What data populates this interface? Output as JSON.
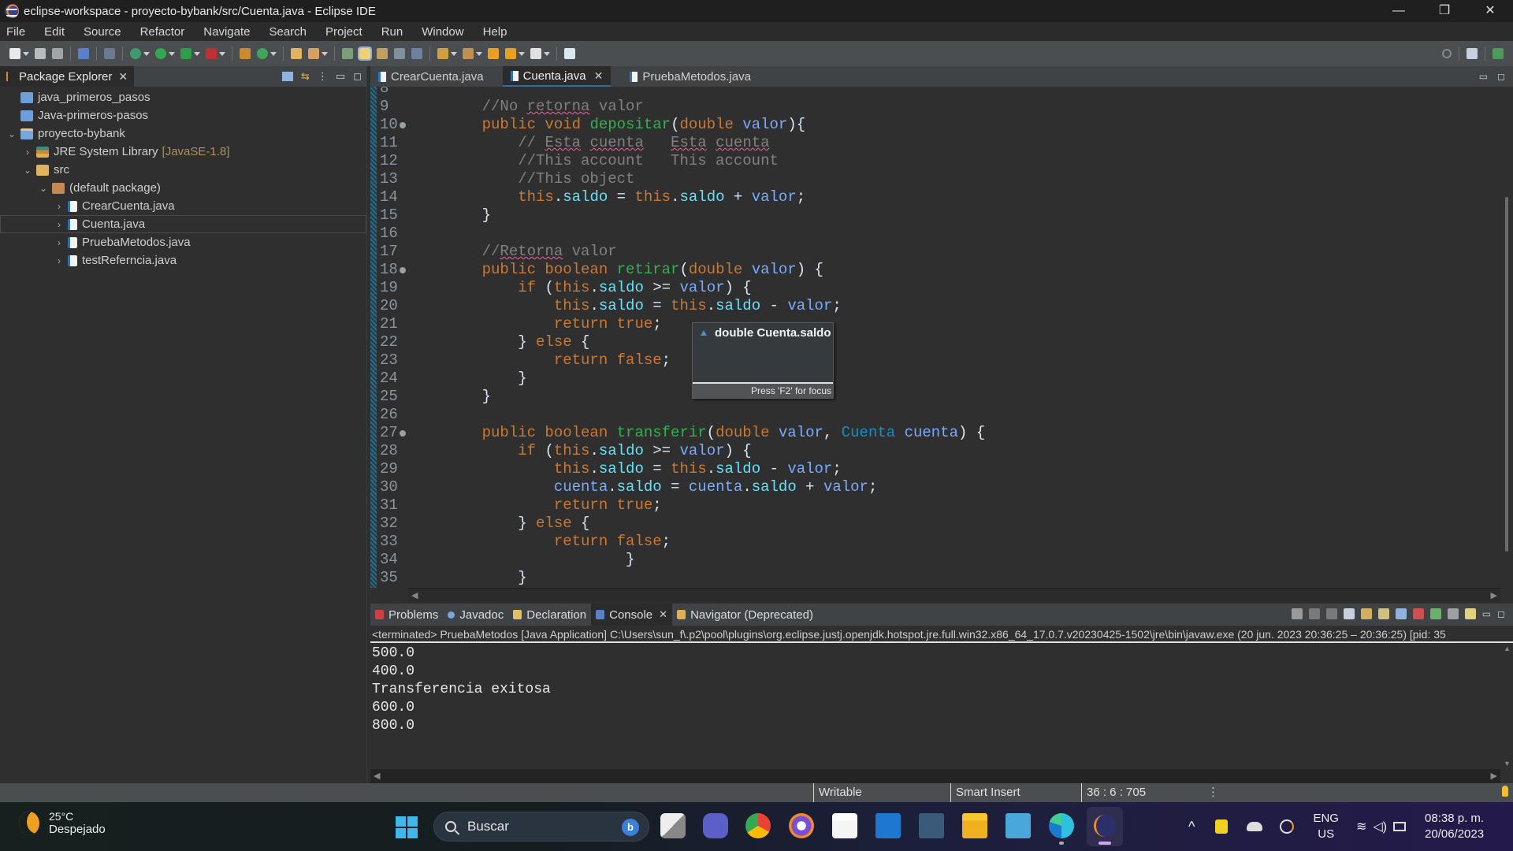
{
  "window": {
    "title": "eclipse-workspace - proyecto-bybank/src/Cuenta.java - Eclipse IDE",
    "controls": {
      "minimize": "—",
      "restore": "❐",
      "close": "✕"
    }
  },
  "menu": [
    "File",
    "Edit",
    "Source",
    "Refactor",
    "Navigate",
    "Search",
    "Project",
    "Run",
    "Window",
    "Help"
  ],
  "package_explorer": {
    "title": "Package Explorer",
    "close": "✕",
    "tree": [
      {
        "label": "java_primeros_pasos",
        "icon": "folder-icon",
        "depth": 0,
        "toggle": ""
      },
      {
        "label": "Java-primeros-pasos",
        "icon": "folder-icon",
        "depth": 0,
        "toggle": ""
      },
      {
        "label": "proyecto-bybank",
        "icon": "project-icon",
        "depth": 0,
        "toggle": "⌄"
      },
      {
        "label": "JRE System Library",
        "extra": "[JavaSE-1.8]",
        "icon": "library-icon",
        "depth": 1,
        "toggle": "›"
      },
      {
        "label": "src",
        "icon": "source-folder-icon",
        "depth": 1,
        "toggle": "⌄"
      },
      {
        "label": "(default package)",
        "icon": "package-icon",
        "depth": 2,
        "toggle": "⌄"
      },
      {
        "label": "CrearCuenta.java",
        "icon": "java-file-icon",
        "depth": 3,
        "toggle": "›"
      },
      {
        "label": "Cuenta.java",
        "icon": "java-file-icon",
        "depth": 3,
        "toggle": "›",
        "selected": true
      },
      {
        "label": "PruebaMetodos.java",
        "icon": "java-file-icon",
        "depth": 3,
        "toggle": "›"
      },
      {
        "label": "testReferncia.java",
        "icon": "java-file-icon",
        "depth": 3,
        "toggle": "›"
      }
    ]
  },
  "editor": {
    "tabs": [
      {
        "label": "CrearCuenta.java",
        "active": false
      },
      {
        "label": "Cuenta.java",
        "active": true,
        "close": "✕"
      },
      {
        "label": "PruebaMetodos.java",
        "active": false
      }
    ],
    "lines": [
      {
        "n": "8",
        "fold": false,
        "tokens": []
      },
      {
        "n": "9",
        "fold": false,
        "tokens": [
          [
            "    ",
            ""
          ],
          [
            "//No ",
            "cmt"
          ],
          [
            "retorna",
            "cmt sq"
          ],
          [
            " valor",
            "cmt"
          ]
        ]
      },
      {
        "n": "10",
        "fold": true,
        "tokens": [
          [
            "    ",
            ""
          ],
          [
            "public void ",
            "kw"
          ],
          [
            "depositar",
            "fn"
          ],
          [
            "(",
            ""
          ],
          [
            "double ",
            "kw"
          ],
          [
            "valor",
            "var"
          ],
          [
            "){",
            ""
          ]
        ]
      },
      {
        "n": "11",
        "fold": false,
        "tokens": [
          [
            "        ",
            ""
          ],
          [
            "// ",
            "cmt"
          ],
          [
            "Esta",
            "cmt sq"
          ],
          [
            " ",
            "cmt"
          ],
          [
            "cuenta",
            "cmt sq"
          ],
          [
            "   ",
            "cmt"
          ],
          [
            "Esta",
            "cmt sq"
          ],
          [
            " ",
            "cmt"
          ],
          [
            "cuenta",
            "cmt sq"
          ]
        ]
      },
      {
        "n": "12",
        "fold": false,
        "tokens": [
          [
            "        ",
            ""
          ],
          [
            "//This account   This account",
            "cmt"
          ]
        ]
      },
      {
        "n": "13",
        "fold": false,
        "tokens": [
          [
            "        ",
            ""
          ],
          [
            "//This object",
            "cmt"
          ]
        ]
      },
      {
        "n": "14",
        "fold": false,
        "tokens": [
          [
            "        ",
            ""
          ],
          [
            "this",
            "kw"
          ],
          [
            ".",
            ""
          ],
          [
            "saldo",
            "fld"
          ],
          [
            " = ",
            ""
          ],
          [
            "this",
            "kw"
          ],
          [
            ".",
            ""
          ],
          [
            "saldo",
            "fld"
          ],
          [
            " + ",
            ""
          ],
          [
            "valor",
            "var"
          ],
          [
            ";",
            ""
          ]
        ]
      },
      {
        "n": "15",
        "fold": false,
        "tokens": [
          [
            "    }",
            ""
          ]
        ]
      },
      {
        "n": "16",
        "fold": false,
        "tokens": []
      },
      {
        "n": "17",
        "fold": false,
        "tokens": [
          [
            "    ",
            ""
          ],
          [
            "//",
            "cmt"
          ],
          [
            "Retorna",
            "cmt sq"
          ],
          [
            " valor",
            "cmt"
          ]
        ]
      },
      {
        "n": "18",
        "fold": true,
        "tokens": [
          [
            "    ",
            ""
          ],
          [
            "public boolean ",
            "kw"
          ],
          [
            "retirar",
            "fn"
          ],
          [
            "(",
            ""
          ],
          [
            "double ",
            "kw"
          ],
          [
            "valor",
            "var"
          ],
          [
            ") {",
            ""
          ]
        ]
      },
      {
        "n": "19",
        "fold": false,
        "tokens": [
          [
            "        ",
            ""
          ],
          [
            "if ",
            "kw"
          ],
          [
            "(",
            ""
          ],
          [
            "this",
            "kw"
          ],
          [
            ".",
            ""
          ],
          [
            "saldo",
            "fld"
          ],
          [
            " >= ",
            ""
          ],
          [
            "valor",
            "var"
          ],
          [
            ") {",
            ""
          ]
        ]
      },
      {
        "n": "20",
        "fold": false,
        "tokens": [
          [
            "            ",
            ""
          ],
          [
            "this",
            "kw"
          ],
          [
            ".",
            ""
          ],
          [
            "saldo",
            "fld"
          ],
          [
            " = ",
            ""
          ],
          [
            "this",
            "kw"
          ],
          [
            ".",
            ""
          ],
          [
            "saldo",
            "fld"
          ],
          [
            " - ",
            ""
          ],
          [
            "valor",
            "var"
          ],
          [
            ";",
            ""
          ]
        ]
      },
      {
        "n": "21",
        "fold": false,
        "tokens": [
          [
            "            ",
            ""
          ],
          [
            "return true",
            "kw"
          ],
          [
            ";",
            ""
          ]
        ]
      },
      {
        "n": "22",
        "fold": false,
        "tokens": [
          [
            "        } ",
            ""
          ],
          [
            "else",
            "kw"
          ],
          [
            " {",
            ""
          ]
        ]
      },
      {
        "n": "23",
        "fold": false,
        "tokens": [
          [
            "            ",
            ""
          ],
          [
            "return false",
            "kw"
          ],
          [
            ";",
            ""
          ]
        ]
      },
      {
        "n": "24",
        "fold": false,
        "tokens": [
          [
            "        }",
            ""
          ]
        ]
      },
      {
        "n": "25",
        "fold": false,
        "tokens": [
          [
            "    }",
            ""
          ]
        ]
      },
      {
        "n": "26",
        "fold": false,
        "tokens": []
      },
      {
        "n": "27",
        "fold": true,
        "tokens": [
          [
            "    ",
            ""
          ],
          [
            "public boolean ",
            "kw"
          ],
          [
            "transferir",
            "fn"
          ],
          [
            "(",
            ""
          ],
          [
            "double ",
            "kw"
          ],
          [
            "valor",
            "var"
          ],
          [
            ", ",
            ""
          ],
          [
            "Cuenta",
            "typ"
          ],
          [
            " ",
            ""
          ],
          [
            "cuenta",
            "var"
          ],
          [
            ") {",
            ""
          ]
        ]
      },
      {
        "n": "28",
        "fold": false,
        "tokens": [
          [
            "        ",
            ""
          ],
          [
            "if ",
            "kw"
          ],
          [
            "(",
            ""
          ],
          [
            "this",
            "kw"
          ],
          [
            ".",
            ""
          ],
          [
            "saldo",
            "fld"
          ],
          [
            " >= ",
            ""
          ],
          [
            "valor",
            "var"
          ],
          [
            ") {",
            ""
          ]
        ]
      },
      {
        "n": "29",
        "fold": false,
        "tokens": [
          [
            "            ",
            ""
          ],
          [
            "this",
            "kw"
          ],
          [
            ".",
            ""
          ],
          [
            "saldo",
            "fld"
          ],
          [
            " = ",
            ""
          ],
          [
            "this",
            "kw"
          ],
          [
            ".",
            ""
          ],
          [
            "saldo",
            "fld"
          ],
          [
            " - ",
            ""
          ],
          [
            "valor",
            "var"
          ],
          [
            ";",
            ""
          ]
        ]
      },
      {
        "n": "30",
        "fold": false,
        "tokens": [
          [
            "            ",
            ""
          ],
          [
            "cuenta",
            "var"
          ],
          [
            ".",
            ""
          ],
          [
            "saldo",
            "fld"
          ],
          [
            " = ",
            ""
          ],
          [
            "cuenta",
            "var"
          ],
          [
            ".",
            ""
          ],
          [
            "saldo",
            "fld"
          ],
          [
            " + ",
            ""
          ],
          [
            "valor",
            "var"
          ],
          [
            ";",
            ""
          ]
        ]
      },
      {
        "n": "31",
        "fold": false,
        "tokens": [
          [
            "            ",
            ""
          ],
          [
            "return true",
            "kw"
          ],
          [
            ";",
            ""
          ]
        ]
      },
      {
        "n": "32",
        "fold": false,
        "tokens": [
          [
            "        } ",
            ""
          ],
          [
            "else",
            "kw"
          ],
          [
            " {",
            ""
          ]
        ]
      },
      {
        "n": "33",
        "fold": false,
        "tokens": [
          [
            "            ",
            ""
          ],
          [
            "return false",
            "kw"
          ],
          [
            ";",
            ""
          ]
        ]
      },
      {
        "n": "34",
        "fold": false,
        "tokens": [
          [
            "                    }",
            ""
          ]
        ]
      },
      {
        "n": "35",
        "fold": false,
        "tokens": [
          [
            "        }",
            ""
          ]
        ]
      }
    ],
    "hover": {
      "title": "double Cuenta.saldo",
      "footer": "Press 'F2' for focus"
    }
  },
  "bottom_panel": {
    "tabs": [
      {
        "label": "Problems",
        "icon": "problems-icon",
        "active": false
      },
      {
        "label": "Javadoc",
        "icon": "javadoc-icon",
        "active": false
      },
      {
        "label": "Declaration",
        "icon": "declaration-icon",
        "active": false
      },
      {
        "label": "Console",
        "icon": "console-icon",
        "active": true,
        "close": "✕"
      },
      {
        "label": "Navigator (Deprecated)",
        "icon": "navigator-icon",
        "active": false
      }
    ],
    "console_status": "<terminated> PruebaMetodos [Java Application] C:\\Users\\sun_f\\.p2\\pool\\plugins\\org.eclipse.justj.openjdk.hotspot.jre.full.win32.x86_64_17.0.7.v20230425-1502\\jre\\bin\\javaw.exe  (20 jun. 2023 20:36:25 – 20:36:25) [pid: 35",
    "output": [
      "500.0",
      "400.0",
      "Transferencia exitosa",
      "600.0",
      "800.0"
    ]
  },
  "statusbar": {
    "writable": "Writable",
    "insert_mode": "Smart Insert",
    "position": "36 : 6 : 705"
  },
  "taskbar": {
    "weather_temp": "25°C",
    "weather_desc": "Despejado",
    "search_label": "Buscar",
    "lang_top": "ENG",
    "lang_bottom": "US",
    "time": "08:38 p. m.",
    "date": "20/06/2023",
    "chevron": "^"
  }
}
